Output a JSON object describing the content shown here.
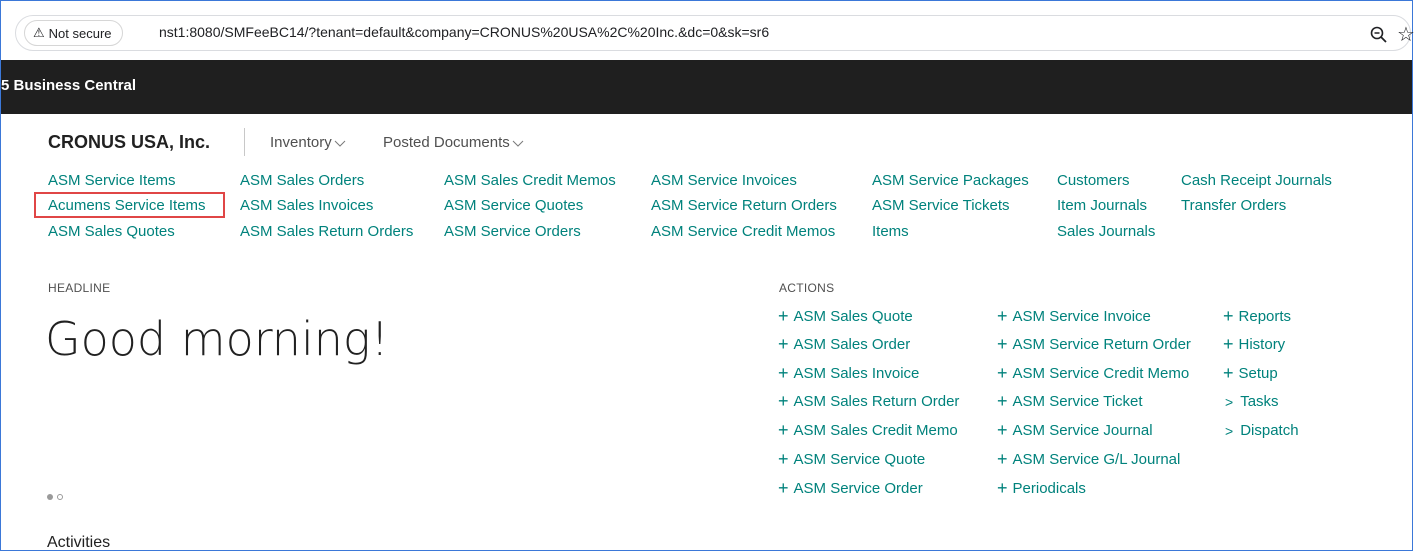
{
  "browser": {
    "security_label": "Not secure",
    "url": "nst1:8080/SMFeeBC14/?tenant=default&company=CRONUS%20USA%2C%20Inc.&dc=0&sk=sr6"
  },
  "appbar": {
    "title": "5 Business Central"
  },
  "nav": {
    "company": "CRONUS USA, Inc.",
    "menus": [
      "Inventory",
      "Posted Documents"
    ]
  },
  "links": {
    "col1": [
      "ASM Service Items",
      "Acumens Service Items",
      "ASM Sales Quotes"
    ],
    "col2": [
      "ASM Sales Orders",
      "ASM Sales Invoices",
      "ASM Sales Return Orders"
    ],
    "col3": [
      "ASM Sales Credit Memos",
      "ASM Service Quotes",
      "ASM Service Orders"
    ],
    "col4": [
      "ASM Service Invoices",
      "ASM Service Return Orders",
      "ASM Service Credit Memos"
    ],
    "col5": [
      "ASM Service Packages",
      "ASM Service Tickets",
      "Items"
    ],
    "col6": [
      "Customers",
      "Item Journals",
      "Sales Journals"
    ],
    "col7": [
      "Cash Receipt Journals",
      "Transfer Orders"
    ]
  },
  "headline": {
    "label": "HEADLINE",
    "text": "Good morning!"
  },
  "activities": {
    "label": "Activities"
  },
  "actions": {
    "label": "ACTIONS",
    "col1": [
      "ASM Sales Quote",
      "ASM Sales Order",
      "ASM Sales Invoice",
      "ASM Sales Return Order",
      "ASM Sales Credit Memo",
      "ASM Service Quote",
      "ASM Service Order"
    ],
    "col2": [
      "ASM Service Invoice",
      "ASM Service Return Order",
      "ASM Service Credit Memo",
      "ASM Service Ticket",
      "ASM Service Journal",
      "ASM Service G/L Journal",
      "Periodicals"
    ],
    "col3": [
      "Reports",
      "History",
      "Setup"
    ],
    "col3_groups": [
      "Tasks",
      "Dispatch"
    ]
  },
  "colors": {
    "link": "#00827c",
    "appbar": "#1f1f1f",
    "highlight": "#e04646"
  }
}
